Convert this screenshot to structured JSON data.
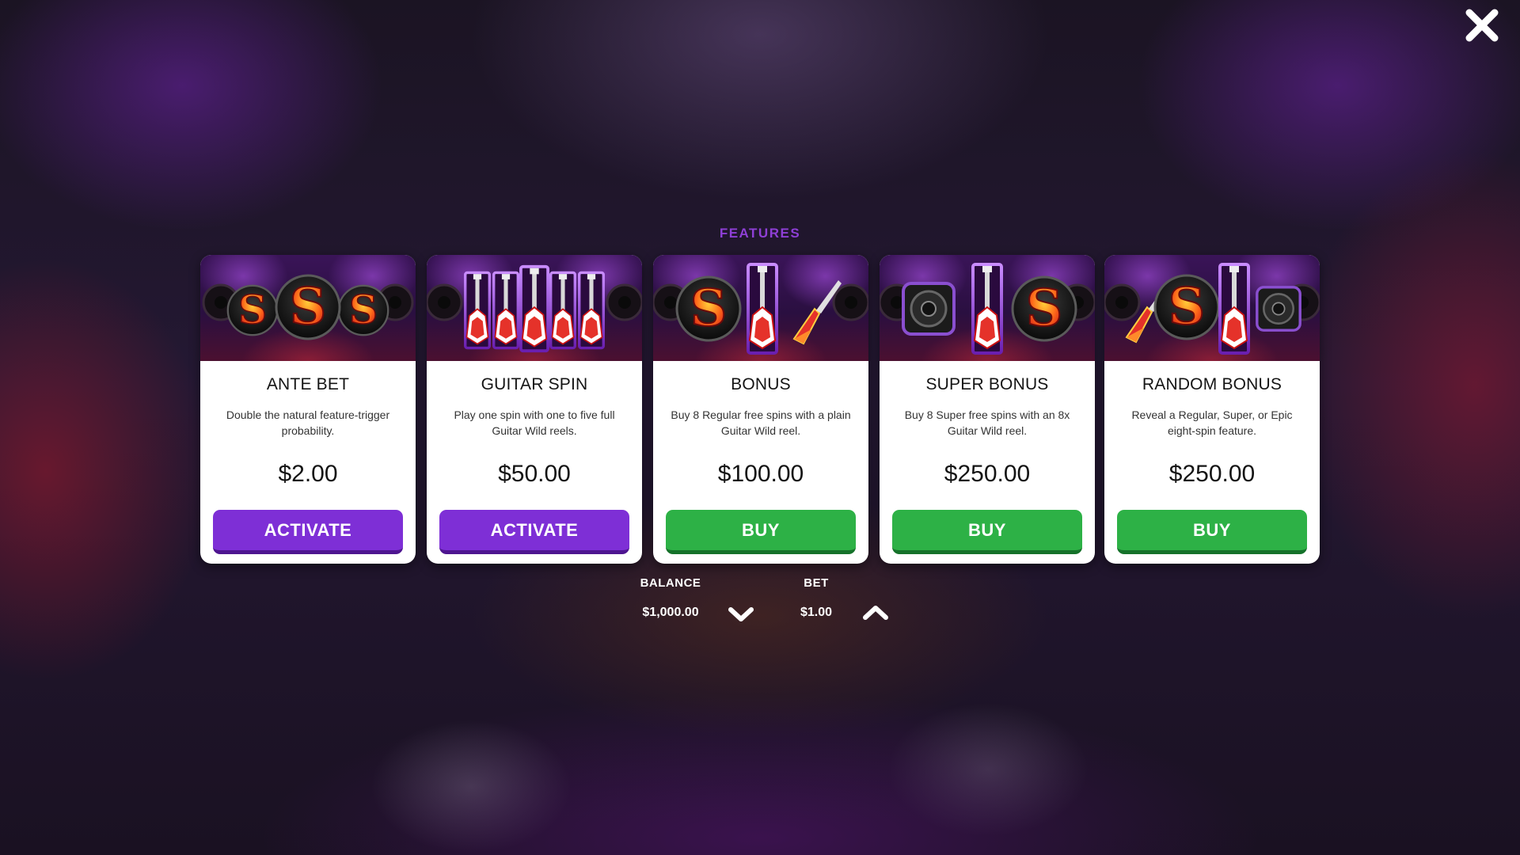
{
  "header": {
    "title": "FEATURES",
    "close_icon": "close-icon"
  },
  "colors": {
    "accent_purple": "#7e2fd6",
    "accent_green": "#2db146",
    "title_purple": "#8e3fd6"
  },
  "cards": [
    {
      "title": "ANTE BET",
      "description": "Double the natural feature-trigger probability.",
      "price": "$2.00",
      "button_label": "ACTIVATE",
      "button_color": "purple"
    },
    {
      "title": "GUITAR SPIN",
      "description": "Play one spin with one to five full Guitar Wild reels.",
      "price": "$50.00",
      "button_label": "ACTIVATE",
      "button_color": "purple"
    },
    {
      "title": "BONUS",
      "description": "Buy 8 Regular free spins with a plain Guitar Wild reel.",
      "price": "$100.00",
      "button_label": "BUY",
      "button_color": "green"
    },
    {
      "title": "SUPER BONUS",
      "description": "Buy 8 Super free spins with an 8x Guitar Wild reel.",
      "price": "$250.00",
      "button_label": "BUY",
      "button_color": "green"
    },
    {
      "title": "RANDOM BONUS",
      "description": "Reveal a Regular, Super, or Epic eight-spin feature.",
      "price": "$250.00",
      "button_label": "BUY",
      "button_color": "green"
    }
  ],
  "footer": {
    "balance_label": "BALANCE",
    "balance_value": "$1,000.00",
    "bet_label": "BET",
    "bet_value": "$1.00",
    "decrease_icon": "chevron-down-icon",
    "increase_icon": "chevron-up-icon"
  }
}
